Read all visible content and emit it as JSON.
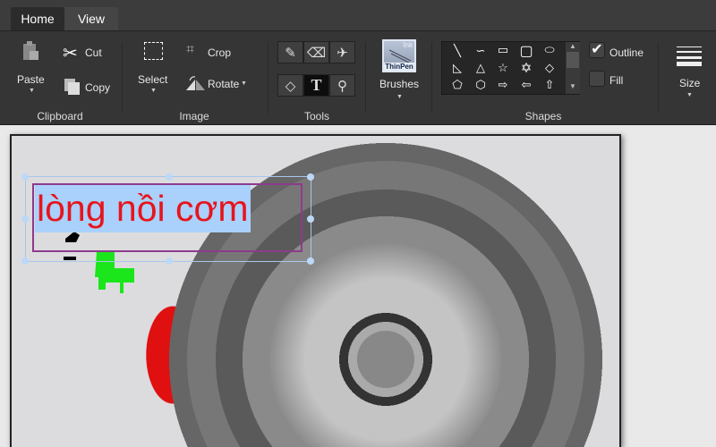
{
  "tabs": [
    {
      "label": "Home"
    },
    {
      "label": "View"
    }
  ],
  "clipboard": {
    "group": "Clipboard",
    "paste": "Paste",
    "cut": "Cut",
    "copy": "Copy"
  },
  "image": {
    "group": "Image",
    "select": "Select",
    "crop": "Crop",
    "rotate": "Rotate"
  },
  "tools": {
    "group": "Tools",
    "items": [
      "pencil",
      "eraser",
      "color-fill-spray",
      "fill-bucket",
      "text",
      "color-picker"
    ]
  },
  "brushes": {
    "label": "Brushes",
    "thumb_top": "Ink",
    "thumb_bottom": "ThinPen"
  },
  "shapes": {
    "group": "Shapes",
    "outline": "Outline",
    "fill": "Fill",
    "outline_checked": true,
    "fill_checked": false
  },
  "size": {
    "label": "Size"
  },
  "canvas": {
    "text": "lòng nồi cơm",
    "text_color": "#e8141c",
    "highlight": "#a9d1fb"
  }
}
